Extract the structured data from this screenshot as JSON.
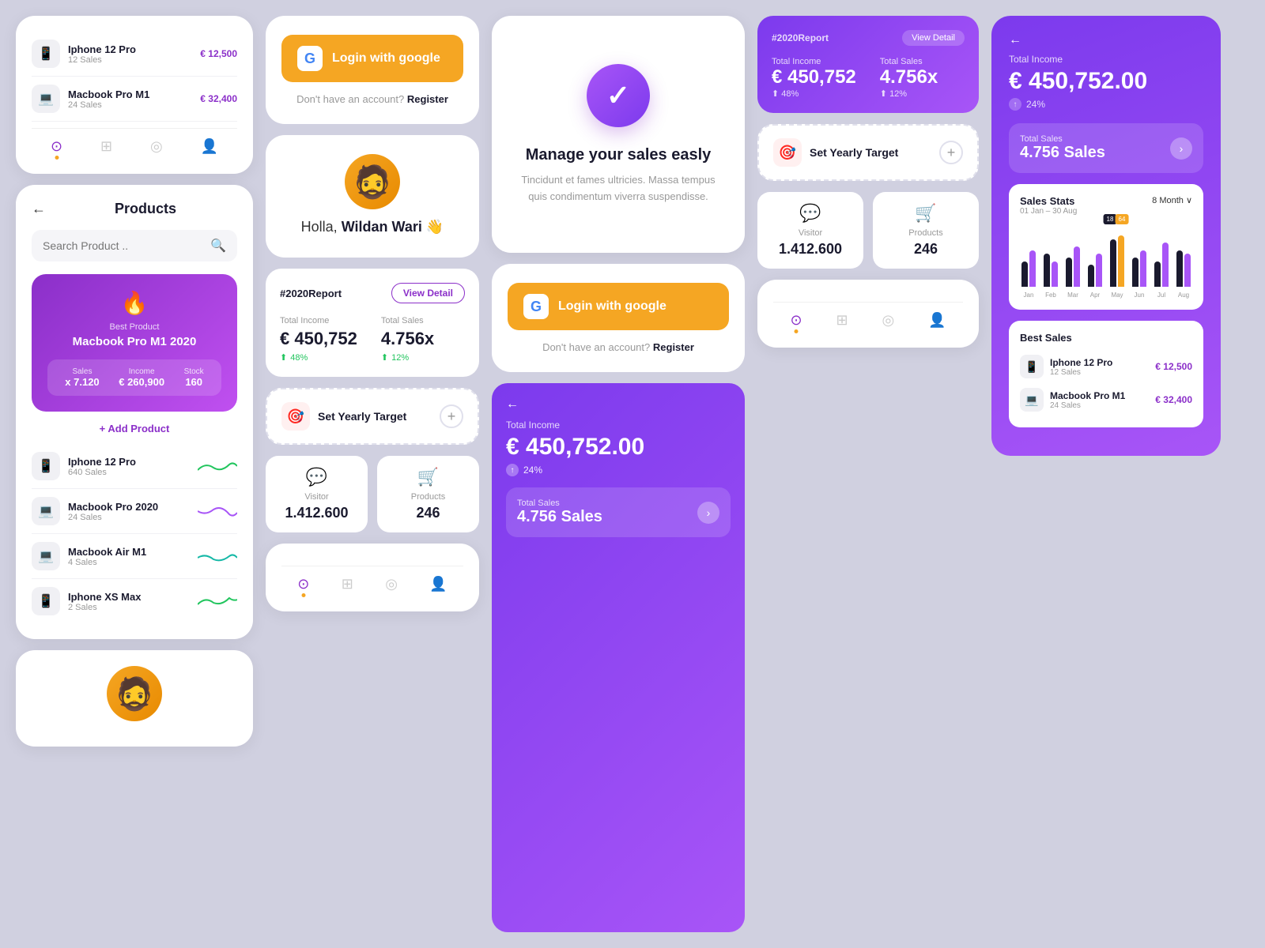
{
  "app": {
    "bg": "#d0d0e0"
  },
  "col1": {
    "topCard": {
      "items": [
        {
          "name": "Iphone 12 Pro",
          "sales": "12 Sales",
          "price": "€ 12,500",
          "sparkColor": "green"
        },
        {
          "name": "Macbook Pro M1",
          "sales": "24 Sales",
          "price": "€ 32,400",
          "sparkColor": "purple"
        }
      ]
    },
    "productsCard": {
      "backLabel": "←",
      "title": "Products",
      "searchPlaceholder": "Search Product ..",
      "bestProductLabel": "Best Product",
      "bestProductName": "Macbook Pro M1 2020",
      "salesLabel": "Sales",
      "salesValue": "x 7.120",
      "incomeLabel": "Income",
      "incomeValue": "€ 260,900",
      "stockLabel": "Stock",
      "stockValue": "160",
      "addProduct": "+ Add Product",
      "items": [
        {
          "name": "Iphone 12 Pro",
          "sales": "640 Sales",
          "sparkColor": "green"
        },
        {
          "name": "Macbook Pro 2020",
          "sales": "24 Sales",
          "sparkColor": "purple"
        },
        {
          "name": "Macbook Air M1",
          "sales": "4 Sales",
          "sparkColor": "teal"
        },
        {
          "name": "Iphone XS Max",
          "sales": "2 Sales",
          "sparkColor": "green"
        }
      ]
    },
    "avatarCard": {
      "emoji": "🧔"
    }
  },
  "col2": {
    "loginCard": {
      "googleBtnText": "Login with google",
      "footerText": "Don't have an account?",
      "registerLabel": "Register"
    },
    "profileCard": {
      "avatar": "🧔",
      "greeting": "Holla,",
      "name": "Wildan Wari",
      "emoji": "👋"
    },
    "reportCard": {
      "tag": "#2020",
      "tagSuffix": "Report",
      "viewDetail": "View Detail",
      "totalIncomeLabel": "Total Income",
      "totalIncomeValue": "€ 450,752",
      "totalSalesLabel": "Total Sales",
      "totalSalesValue": "4.756x",
      "incomeChange": "48%",
      "salesChange": "12%",
      "incomeUp": true,
      "salesUp": true
    },
    "yearlyTarget": {
      "label": "Set Yearly Target",
      "icon": "🎯"
    },
    "statsRow": {
      "visitor": {
        "icon": "💬",
        "label": "Visitor",
        "value": "1.412.600"
      },
      "products": {
        "icon": "🛒",
        "label": "Products",
        "value": "246"
      }
    }
  },
  "col3": {
    "onboardCard": {
      "icon": "✓",
      "title": "Manage your sales easly",
      "desc": "Tincidunt et fames ultricies. Massa tempus quis condimentum viverra suspendisse."
    },
    "loginCard": {
      "googleBtnText": "Login with google",
      "footerText": "Don't have an account?",
      "registerLabel": "Register"
    },
    "partialPurpleCard": {
      "label": "Total Income",
      "value": "€ 450,752.00",
      "sub": "24%",
      "salesLabel": "Total Sales",
      "salesValue": "4.756 Sales"
    }
  },
  "col4": {
    "reportPurple": {
      "tag": "#2020",
      "tagSuffix": "Report",
      "viewDetail": "View Detail",
      "totalIncomeLabel": "Total Income",
      "totalIncomeValue": "€ 450,752",
      "totalSalesLabel": "Total Sales",
      "totalSalesValue": "4.756x",
      "incomeChange": "48%",
      "salesChange": "12%"
    },
    "yearlyTarget": {
      "label": "Set Yearly Target",
      "icon": "🎯"
    },
    "stats": {
      "visitor": {
        "icon": "💬",
        "label": "Visitor",
        "value": "1.412.600"
      },
      "products": {
        "icon": "🛒",
        "label": "Products",
        "value": "246"
      }
    }
  },
  "rightCol": {
    "back": "←",
    "totalIncomeLabel": "Total Income",
    "totalIncomeValue": "€ 450,752.00",
    "totalIncomeSub": "24%",
    "totalSalesLabel": "Total Sales",
    "totalSalesValue": "4.756 Sales",
    "chartTitle": "Sales Stats",
    "chartDate": "01 Jan – 30 Aug",
    "chartPeriod": "8 Month ∨",
    "chartBars": [
      {
        "label": "Jan",
        "dark": 35,
        "purple": 50,
        "highlight": false
      },
      {
        "label": "Feb",
        "dark": 45,
        "purple": 35,
        "highlight": false
      },
      {
        "label": "Mar",
        "dark": 40,
        "purple": 55,
        "highlight": false
      },
      {
        "label": "Apr",
        "dark": 30,
        "purple": 45,
        "highlight": false
      },
      {
        "label": "May",
        "dark": 65,
        "purple": 70,
        "highlight": true,
        "tooltip1": "18",
        "tooltip2": "64"
      },
      {
        "label": "Jun",
        "dark": 40,
        "purple": 50,
        "highlight": false
      },
      {
        "label": "Jul",
        "dark": 35,
        "purple": 60,
        "highlight": false
      },
      {
        "label": "Aug",
        "dark": 50,
        "purple": 45,
        "highlight": false
      }
    ],
    "bestSalesTitle": "Best Sales",
    "bestSales": [
      {
        "name": "Iphone 12 Pro",
        "sales": "12 Sales",
        "price": "€ 12,500"
      },
      {
        "name": "Macbook Pro M1",
        "sales": "24 Sales",
        "price": "€ 32,400"
      }
    ]
  }
}
